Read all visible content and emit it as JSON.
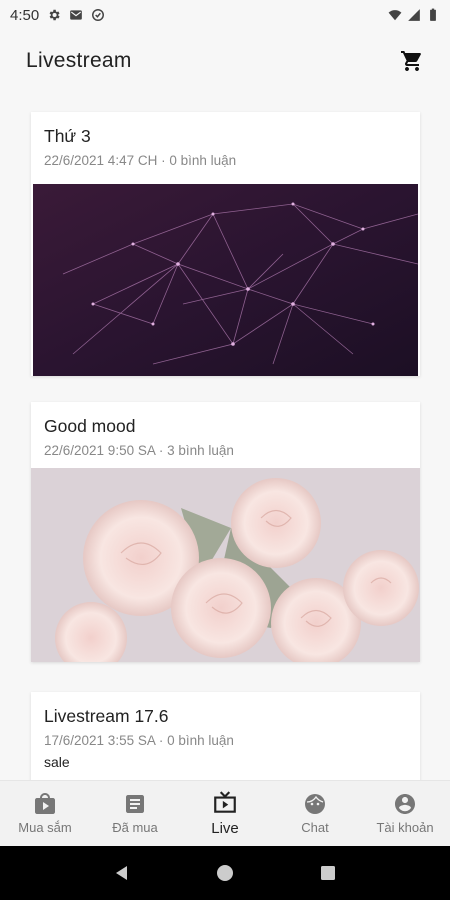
{
  "status_bar": {
    "time": "4:50"
  },
  "app_bar": {
    "title": "Livestream"
  },
  "posts": [
    {
      "title": "Thứ 3",
      "meta": "22/6/2021 4:47 CH · 0 bình luận"
    },
    {
      "title": "Good mood",
      "meta": "22/6/2021 9:50 SA · 3 bình luận"
    },
    {
      "title": "Livestream 17.6",
      "meta": "17/6/2021 3:55 SA · 0 bình luận",
      "description": "sale"
    }
  ],
  "bottom_nav": {
    "active_index": 2,
    "items": [
      {
        "label": "Mua sắm",
        "icon": "shopping-bag-icon"
      },
      {
        "label": "Đã mua",
        "icon": "receipt-icon"
      },
      {
        "label": "Live",
        "icon": "tv-icon"
      },
      {
        "label": "Chat",
        "icon": "face-icon"
      },
      {
        "label": "Tài khoản",
        "icon": "account-icon"
      }
    ]
  },
  "colors": {
    "background": "#f7f7f7",
    "card": "#ffffff",
    "text": "#222222",
    "meta": "#888888",
    "system_nav": "#000000"
  }
}
